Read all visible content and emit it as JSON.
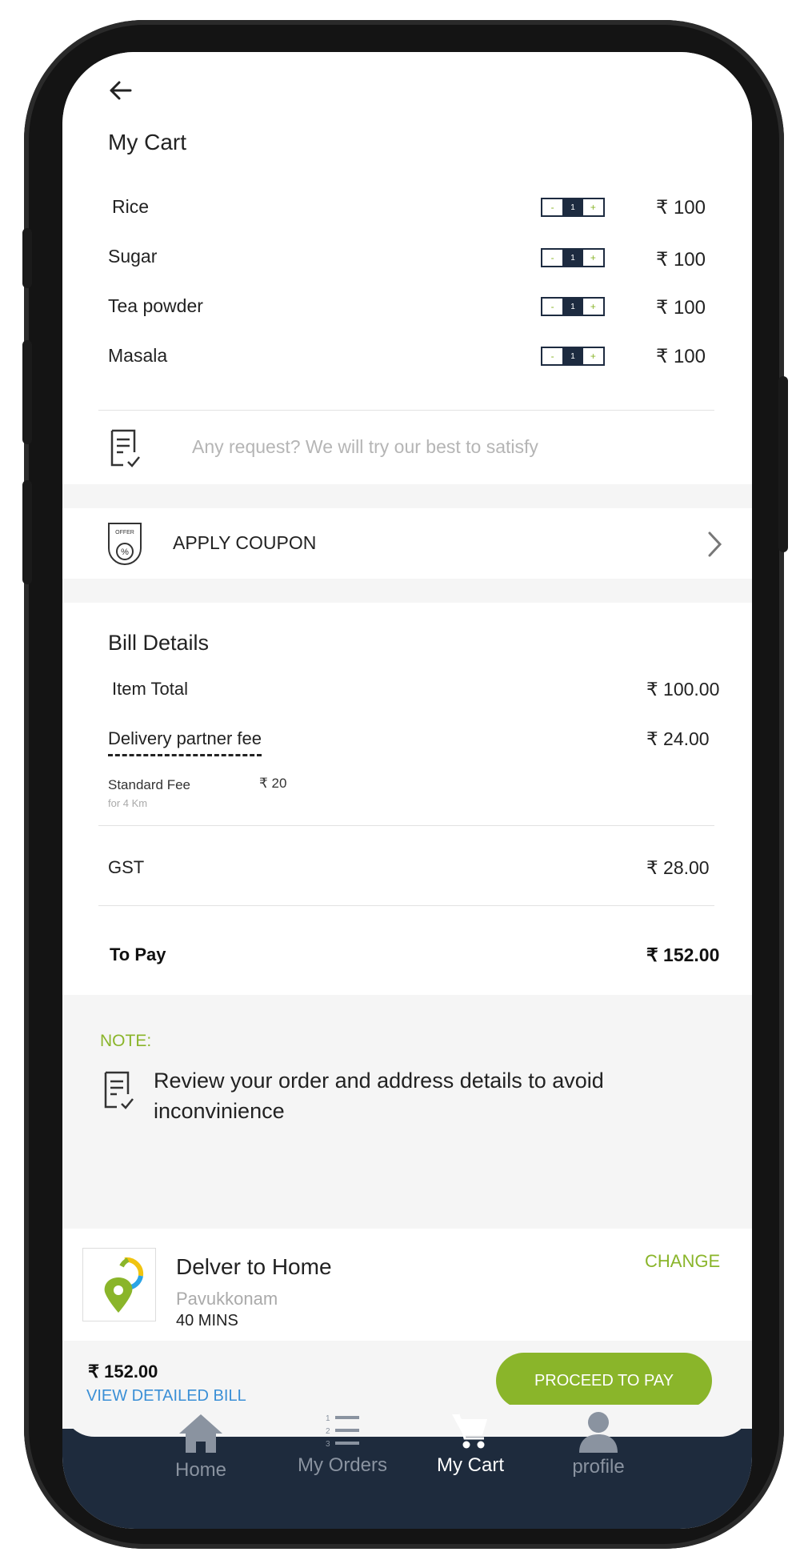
{
  "header": {
    "back_icon": "back-arrow-icon",
    "title": "My Cart"
  },
  "cart_items": [
    {
      "name": "Rice",
      "quantity": "1",
      "price": "₹ 100"
    },
    {
      "name": "Sugar",
      "quantity": "1",
      "price": "₹ 100"
    },
    {
      "name": "Tea powder",
      "quantity": "1",
      "price": "₹ 100"
    },
    {
      "name": "Masala",
      "quantity": "1",
      "price": "₹ 100"
    }
  ],
  "stepper": {
    "minus": "-",
    "plus": "+"
  },
  "request": {
    "placeholder": "Any request? We will try our best to satisfy"
  },
  "coupon": {
    "badge_text": "OFFER",
    "percent": "%",
    "label": "APPLY COUPON"
  },
  "bill": {
    "title": "Bill Details",
    "item_total_label": "Item Total",
    "item_total_value": "₹ 100.00",
    "delivery_label": "Delivery partner fee",
    "delivery_value": "₹ 24.00",
    "standard_fee_label": "Standard Fee",
    "standard_fee_value": "₹ 20",
    "distance_label": "for 4 Km",
    "gst_label": "GST",
    "gst_value": "₹ 28.00",
    "to_pay_label": "To Pay",
    "to_pay_value": "₹ 152.00"
  },
  "note": {
    "heading": "NOTE:",
    "text": "Review your order and address details to avoid inconvinience"
  },
  "delivery": {
    "title": "Delver to Home",
    "location": "Pavukkonam",
    "eta": "40 MINS",
    "change_label": "CHANGE"
  },
  "footer": {
    "total": "₹ 152.00",
    "view_bill_label": "VIEW DETAILED BILL",
    "proceed_label": "PROCEED TO PAY"
  },
  "bottom_nav": [
    {
      "label": "Home",
      "icon": "home-icon",
      "active": false
    },
    {
      "label": "My Orders",
      "icon": "orders-list-icon",
      "active": false
    },
    {
      "label": "My Cart",
      "icon": "cart-icon",
      "active": true
    },
    {
      "label": "profile",
      "icon": "profile-icon",
      "active": false
    }
  ],
  "colors": {
    "accent_green": "#8ab52a",
    "nav_bg": "#1e2b3d",
    "link_blue": "#3a8fd6",
    "text_dark": "#222222"
  }
}
